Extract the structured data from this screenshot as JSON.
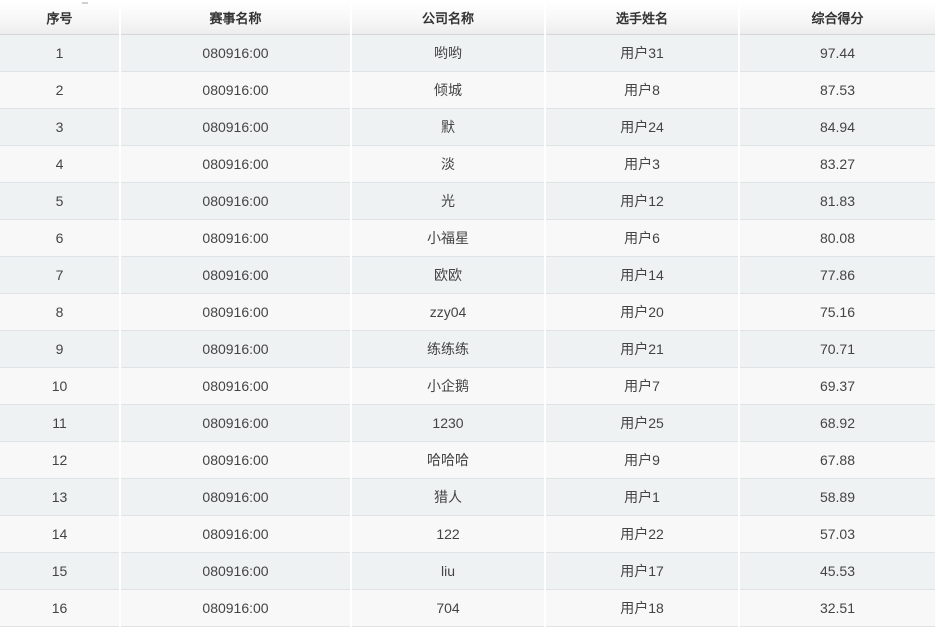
{
  "table": {
    "headers": [
      "序号",
      "赛事名称",
      "公司名称",
      "选手姓名",
      "综合得分"
    ],
    "rows": [
      [
        "1",
        "080916:00",
        "哟哟",
        "用户31",
        "97.44"
      ],
      [
        "2",
        "080916:00",
        "倾城",
        "用户8",
        "87.53"
      ],
      [
        "3",
        "080916:00",
        "默",
        "用户24",
        "84.94"
      ],
      [
        "4",
        "080916:00",
        "淡",
        "用户3",
        "83.27"
      ],
      [
        "5",
        "080916:00",
        "光",
        "用户12",
        "81.83"
      ],
      [
        "6",
        "080916:00",
        "小福星",
        "用户6",
        "80.08"
      ],
      [
        "7",
        "080916:00",
        "欧欧",
        "用户14",
        "77.86"
      ],
      [
        "8",
        "080916:00",
        "zzy04",
        "用户20",
        "75.16"
      ],
      [
        "9",
        "080916:00",
        "练练练",
        "用户21",
        "70.71"
      ],
      [
        "10",
        "080916:00",
        "小企鹅",
        "用户7",
        "69.37"
      ],
      [
        "11",
        "080916:00",
        "1230",
        "用户25",
        "68.92"
      ],
      [
        "12",
        "080916:00",
        "哈哈哈",
        "用户9",
        "67.88"
      ],
      [
        "13",
        "080916:00",
        "猎人",
        "用户1",
        "58.89"
      ],
      [
        "14",
        "080916:00",
        "122",
        "用户22",
        "57.03"
      ],
      [
        "15",
        "080916:00",
        "liu",
        "用户17",
        "45.53"
      ],
      [
        "16",
        "080916:00",
        "704",
        "用户18",
        "32.51"
      ]
    ]
  },
  "colors": {
    "header_bg": "#f4f4f4",
    "row_odd_bg": "#eef2f3",
    "row_even_bg": "#f8f8f8",
    "text": "#444444"
  }
}
